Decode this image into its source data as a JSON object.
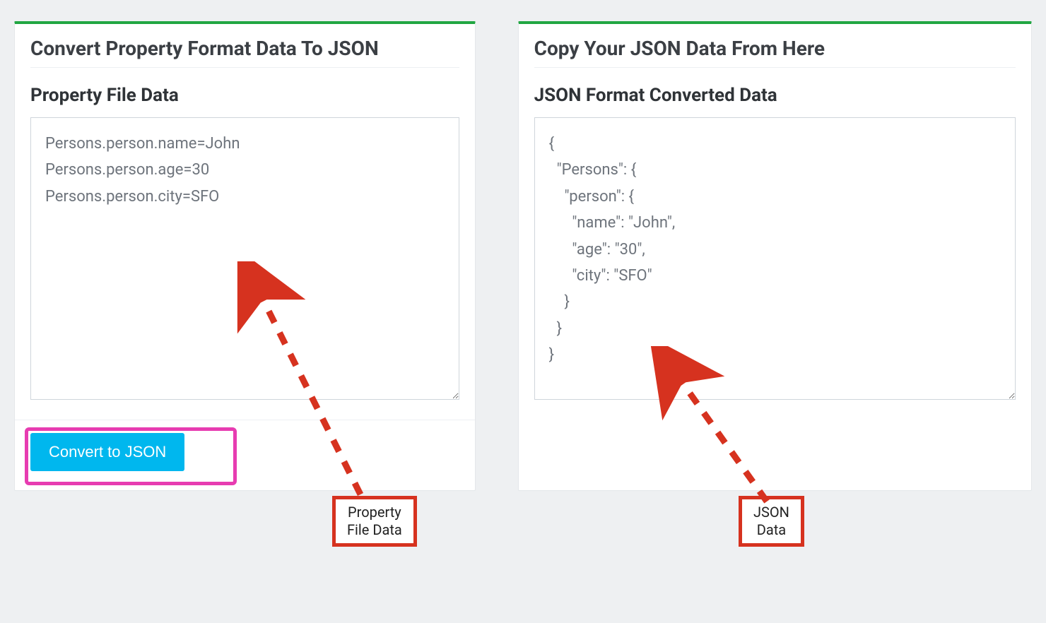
{
  "left_panel": {
    "title": "Convert Property Format Data To JSON",
    "section_title": "Property File Data",
    "textarea_value": "Persons.person.name=John\nPersons.person.age=30\nPersons.person.city=SFO",
    "button_label": "Convert to JSON"
  },
  "right_panel": {
    "title": "Copy Your JSON Data From Here",
    "section_title": "JSON Format Converted Data",
    "textarea_value": "{\n  \"Persons\": {\n    \"person\": {\n      \"name\": \"John\",\n      \"age\": \"30\",\n      \"city\": \"SFO\"\n    }\n  }\n}"
  },
  "annotations": {
    "left_label": "Property\nFile Data",
    "right_label": "JSON\nData"
  },
  "colors": {
    "accent_green": "#21a642",
    "button_blue": "#00b7ee",
    "highlight_pink": "#e73cb1",
    "annotation_red": "#d6321f"
  }
}
